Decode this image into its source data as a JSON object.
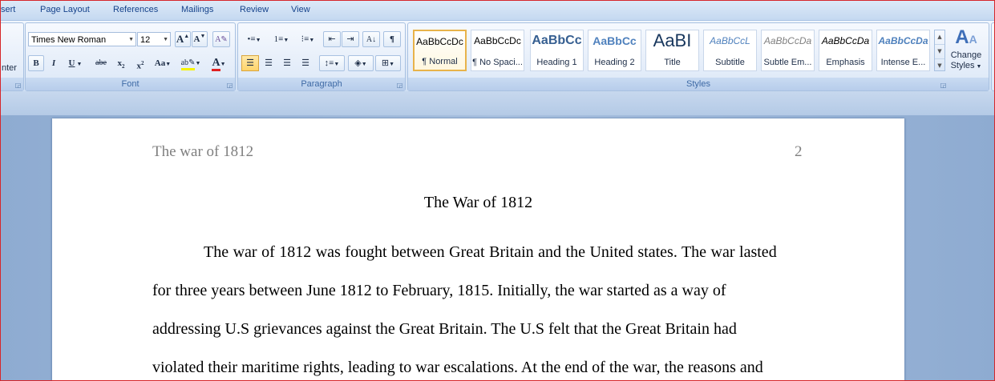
{
  "tabs": [
    "sert",
    "Page Layout",
    "References",
    "Mailings",
    "Review",
    "View"
  ],
  "ribbon": {
    "clipboard_partial": "nter",
    "font": {
      "label": "Font",
      "family": "Times New Roman",
      "size": "12",
      "grow": "A",
      "shrink": "A",
      "bold": "B",
      "italic": "I",
      "underline": "U",
      "strike": "abe",
      "subscript": "x",
      "superscript": "x",
      "change_case": "Aa",
      "highlight": "ab",
      "font_color": "A",
      "font_color_value": "#e02020",
      "highlight_color_value": "#f6f300"
    },
    "paragraph": {
      "label": "Paragraph",
      "show_marks": "¶"
    },
    "styles": {
      "label": "Styles",
      "items": [
        {
          "sample": "AaBbCcDc",
          "name": "¶ Normal"
        },
        {
          "sample": "AaBbCcDc",
          "name": "¶ No Spaci..."
        },
        {
          "sample": "AaBbCc",
          "name": "Heading 1"
        },
        {
          "sample": "AaBbCc",
          "name": "Heading 2"
        },
        {
          "sample": "AaBI",
          "name": "Title"
        },
        {
          "sample": "AaBbCcL",
          "name": "Subtitle"
        },
        {
          "sample": "AaBbCcDa",
          "name": "Subtle Em..."
        },
        {
          "sample": "AaBbCcDa",
          "name": "Emphasis"
        },
        {
          "sample": "AaBbCcDa",
          "name": "Intense E..."
        }
      ],
      "change_styles_line1": "Change",
      "change_styles_line2": "Styles"
    }
  },
  "document": {
    "header_left": "The war of 1812",
    "header_right": "2",
    "title": "The War of 1812",
    "lines": [
      "The war of 1812 was fought between Great Britain and the United states. The war lasted",
      "for three years between June 1812 to February, 1815. Initially, the war started as a way of",
      "addressing U.S grievances against the Great Britain. The U.S felt that the Great Britain had",
      "violated their maritime rights, leading to war escalations. At the end of the war, the reasons and"
    ]
  }
}
